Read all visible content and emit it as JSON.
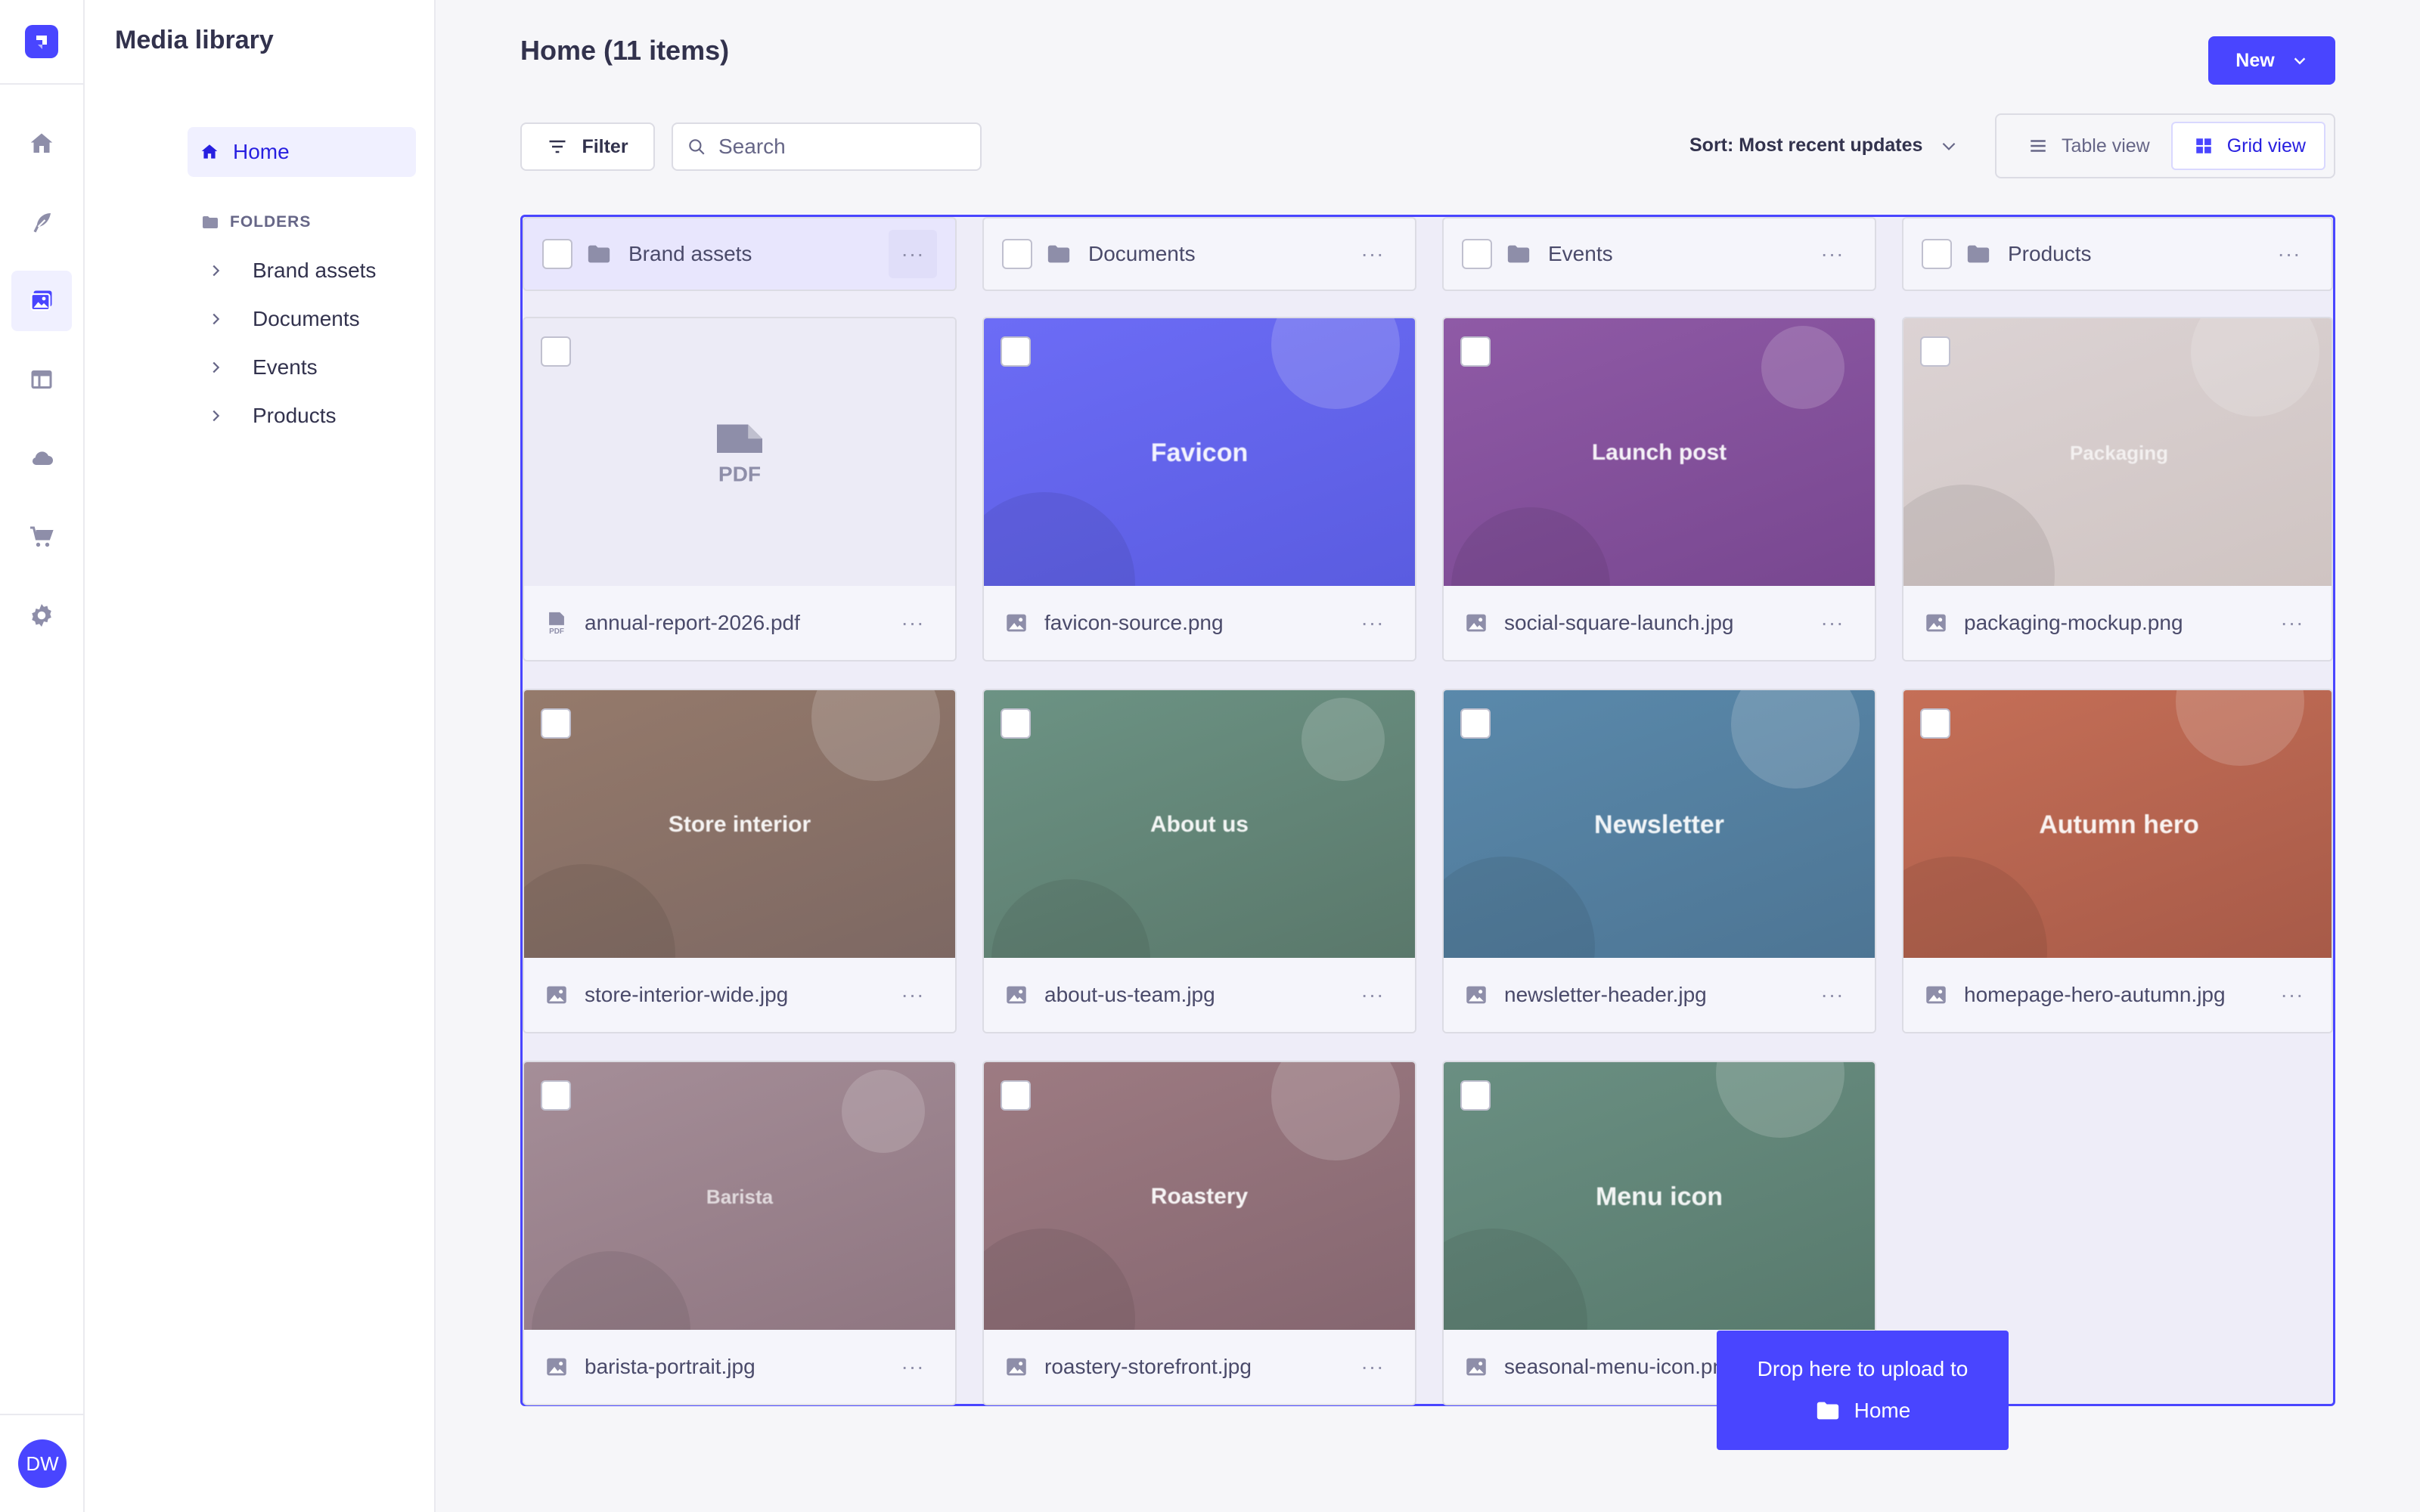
{
  "app": {
    "avatar_initials": "DW",
    "rail_items": [
      "home-icon",
      "feather-icon",
      "media-library-icon",
      "layout-icon",
      "cloud-icon",
      "cart-icon",
      "settings-icon"
    ],
    "active_rail_item": "media-library-icon",
    "accent_color": "#4945ff"
  },
  "subnav": {
    "title": "Media library",
    "home_label": "Home",
    "folders_heading": "FOLDERS",
    "folders": [
      "Brand assets",
      "Documents",
      "Events",
      "Products"
    ]
  },
  "header": {
    "title": "Home (11 items)",
    "new_button_label": "New"
  },
  "toolbar": {
    "filter_label": "Filter",
    "search_placeholder": "Search",
    "sort_label": "Sort: Most recent updates",
    "table_view_label": "Table view",
    "grid_view_label": "Grid view",
    "active_view": "grid"
  },
  "folders": [
    {
      "name": "Brand assets"
    },
    {
      "name": "Documents"
    },
    {
      "name": "Events"
    },
    {
      "name": "Products"
    }
  ],
  "assets": [
    {
      "filename": "annual-report-2026.pdf",
      "preview_label": "PDF",
      "type": "pdf",
      "bg_from": "#ecebf6",
      "bg_to": "#ecebf6"
    },
    {
      "filename": "favicon-source.png",
      "preview_label": "Favicon",
      "type": "image",
      "bg_from": "#6c6cf6",
      "bg_to": "#5a5ce0"
    },
    {
      "filename": "social-square-launch.jpg",
      "preview_label": "Launch post",
      "type": "image",
      "bg_from": "#8f5aa6",
      "bg_to": "#784790"
    },
    {
      "filename": "packaging-mockup.png",
      "preview_label": "Packaging",
      "type": "image",
      "bg_from": "#dcd3d4",
      "bg_to": "#cfc4c2"
    },
    {
      "filename": "store-interior-wide.jpg",
      "preview_label": "Store interior",
      "type": "image",
      "bg_from": "#957a6b",
      "bg_to": "#7d6863"
    },
    {
      "filename": "about-us-team.jpg",
      "preview_label": "About us",
      "type": "image",
      "bg_from": "#6c9384",
      "bg_to": "#5a786b"
    },
    {
      "filename": "newsletter-header.jpg",
      "preview_label": "Newsletter",
      "type": "image",
      "bg_from": "#5a89ab",
      "bg_to": "#4d7594"
    },
    {
      "filename": "homepage-hero-autumn.jpg",
      "preview_label": "Autumn hero",
      "type": "image",
      "bg_from": "#c56f57",
      "bg_to": "#a75a48"
    },
    {
      "filename": "barista-portrait.jpg",
      "preview_label": "Barista",
      "type": "image",
      "bg_from": "#a58e98",
      "bg_to": "#8f7681"
    },
    {
      "filename": "roastery-storefront.jpg",
      "preview_label": "Roastery",
      "type": "image",
      "bg_from": "#9d7b82",
      "bg_to": "#856670"
    },
    {
      "filename": "seasonal-menu-icon.png",
      "visible_filename": "al-menu-icon.png",
      "preview_label": "Menu icon",
      "type": "image",
      "bg_from": "#6a8f82",
      "bg_to": "#587a6d"
    }
  ],
  "drop_toast": {
    "line1": "Drop here to upload to",
    "folder": "Home"
  }
}
